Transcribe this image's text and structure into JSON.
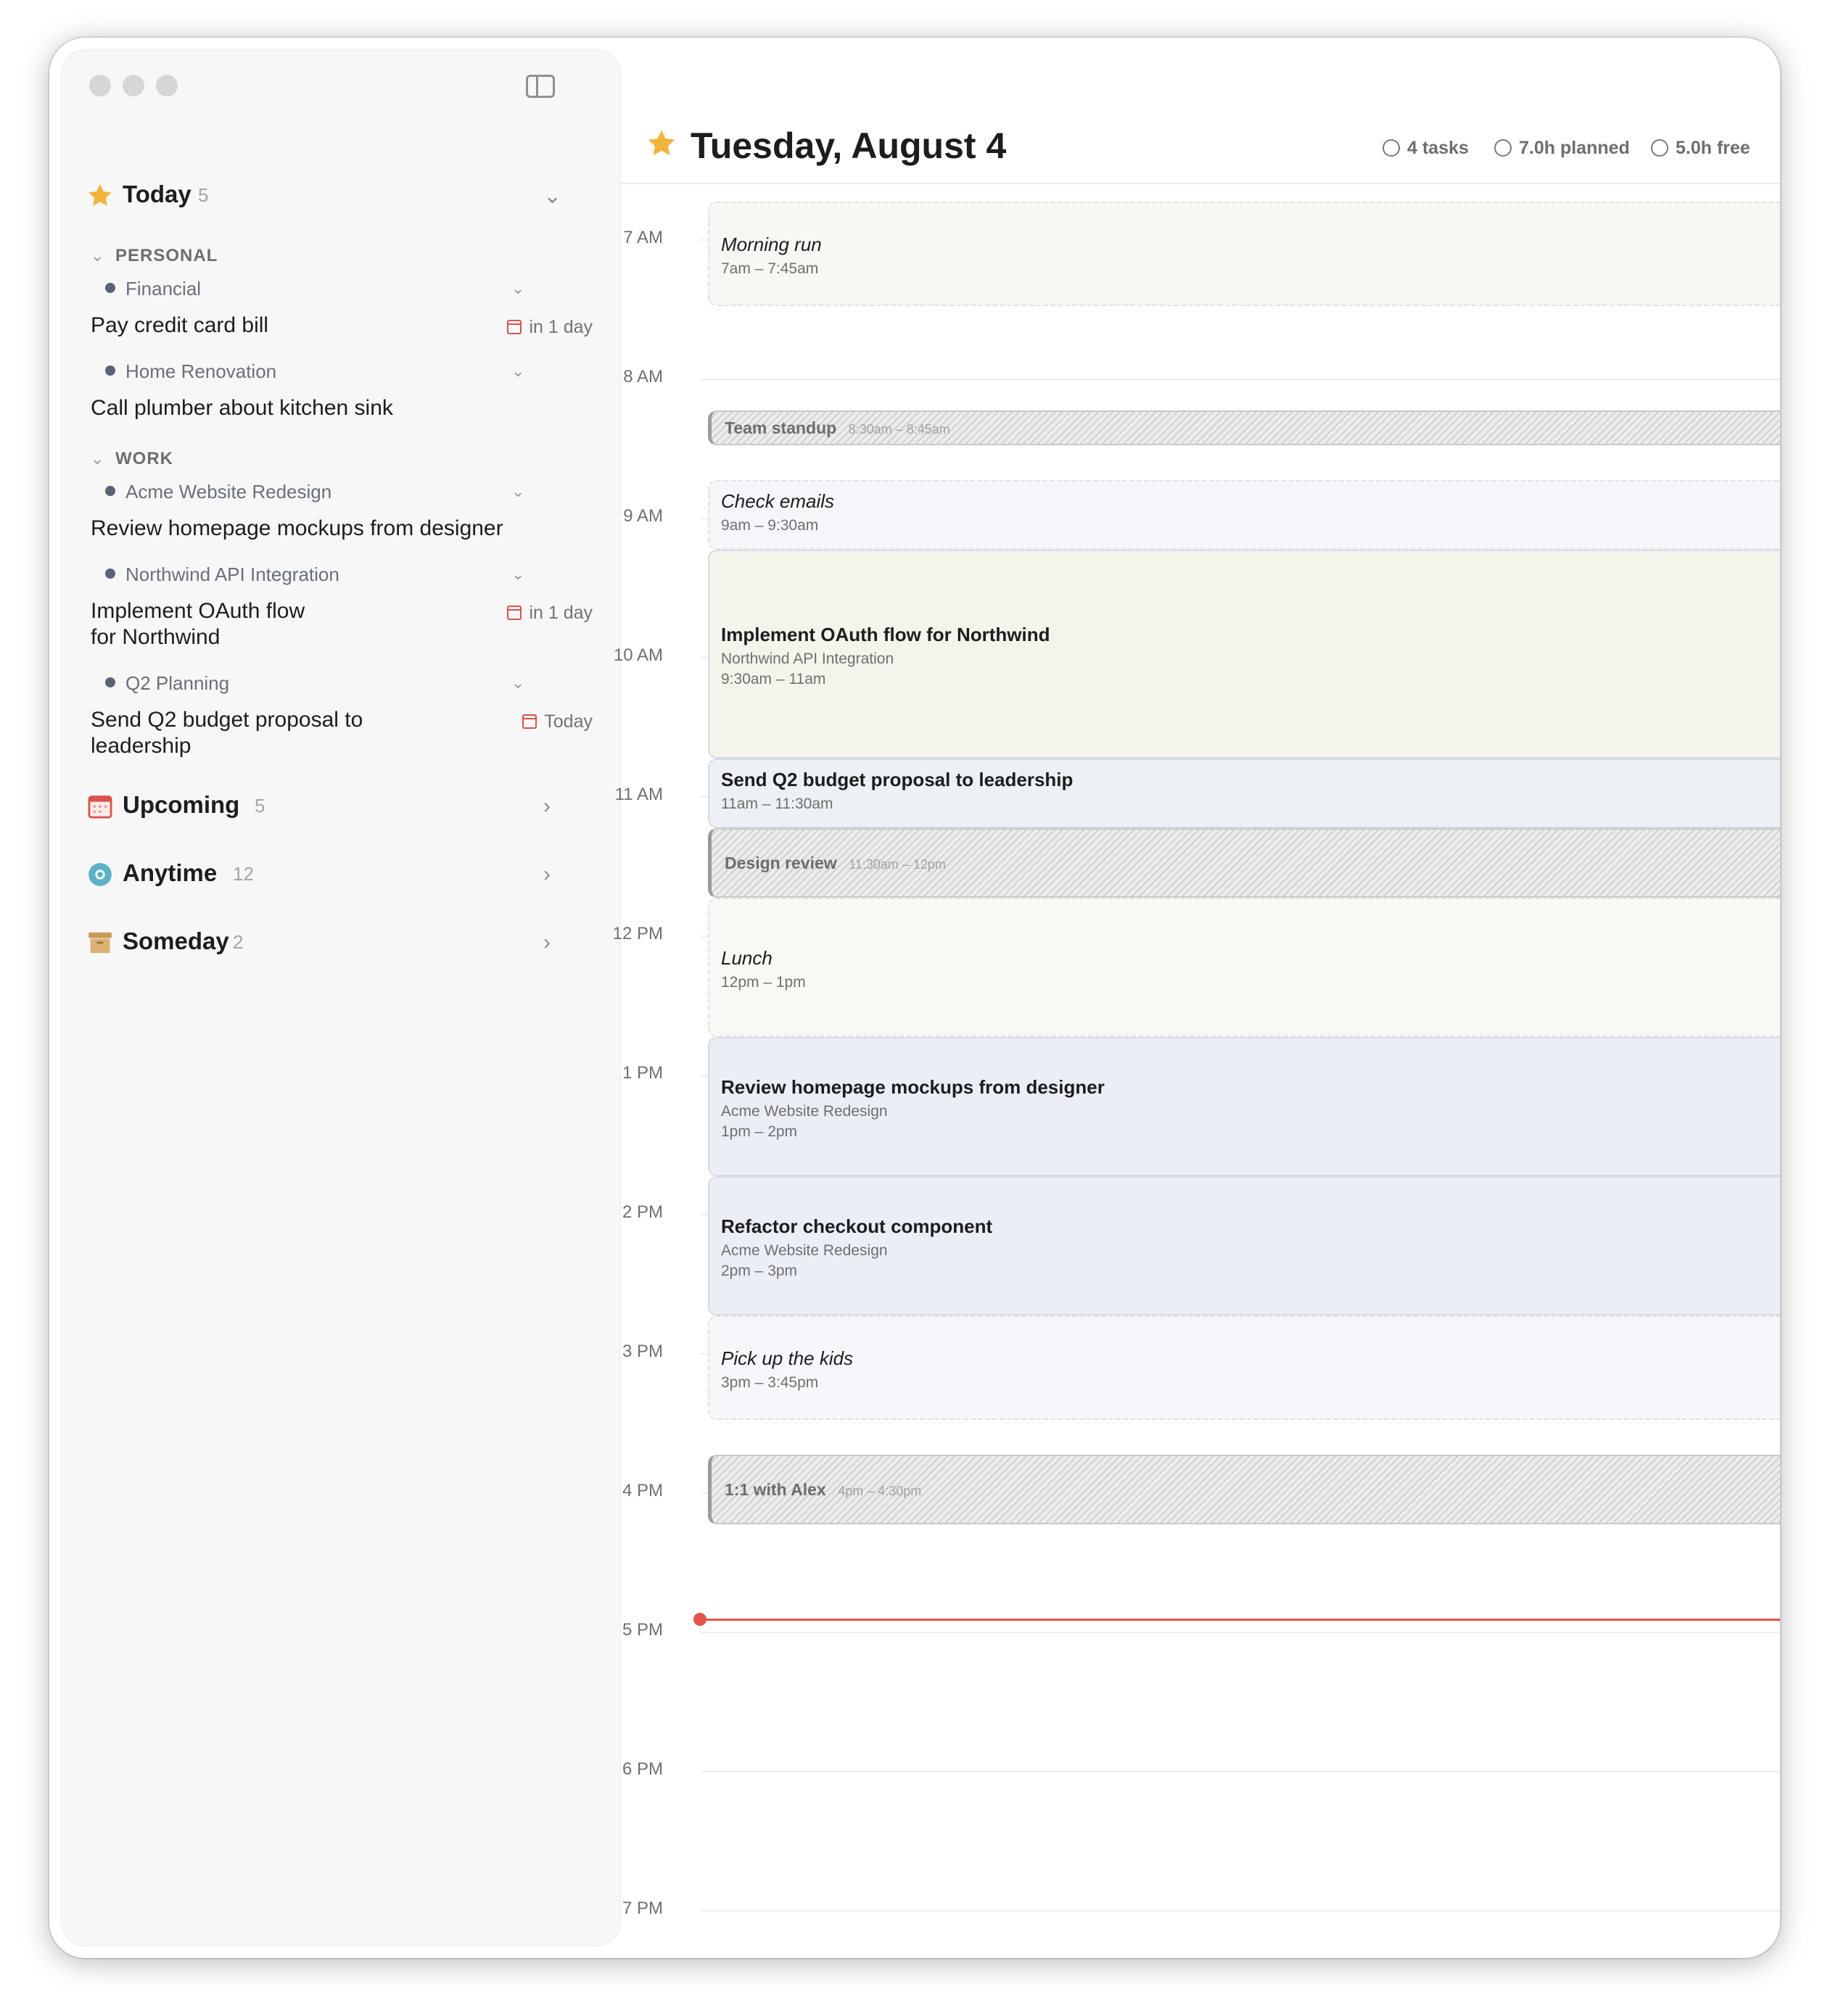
{
  "sidebar": {
    "today": {
      "label": "Today",
      "count": "5"
    },
    "groups": [
      {
        "name": "PERSONAL",
        "projects": [
          {
            "name": "Financial",
            "tasks": [
              {
                "title": "Pay credit card bill",
                "due": "in 1 day"
              }
            ]
          },
          {
            "name": "Home Renovation",
            "tasks": [
              {
                "title": "Call plumber about kitchen sink",
                "due": ""
              }
            ]
          }
        ]
      },
      {
        "name": "WORK",
        "projects": [
          {
            "name": "Acme Website Redesign",
            "tasks": [
              {
                "title": "Review homepage mockups from designer",
                "due": ""
              }
            ]
          },
          {
            "name": "Northwind API Integration",
            "tasks": [
              {
                "title": "Implement OAuth flow for Northwind",
                "due": "in 1 day"
              }
            ]
          },
          {
            "name": "Q2 Planning",
            "tasks": [
              {
                "title": "Send Q2 budget proposal to leadership",
                "due": "Today"
              }
            ]
          }
        ]
      }
    ],
    "sections": [
      {
        "label": "Upcoming",
        "count": "5",
        "icon": "calendar-icon"
      },
      {
        "label": "Anytime",
        "count": "12",
        "icon": "circle-icon"
      },
      {
        "label": "Someday",
        "count": "2",
        "icon": "archive-box-icon"
      }
    ]
  },
  "header": {
    "title": "Tuesday, August 4",
    "tasks": "4 tasks",
    "planned": "7.0h planned",
    "free": "5.0h free"
  },
  "timeline": {
    "hours": [
      "7 AM",
      "8 AM",
      "9 AM",
      "10 AM",
      "11 AM",
      "12 PM",
      "1 PM",
      "2 PM",
      "3 PM",
      "4 PM",
      "5 PM",
      "6 PM",
      "7 PM"
    ],
    "events": [
      {
        "title": "Morning run",
        "time": "7am – 7:45am",
        "kind": "personal",
        "color": "#f6f8f4"
      },
      {
        "title": "Team standup",
        "time": "8:30am – 8:45am",
        "kind": "meeting"
      },
      {
        "title": "Check emails",
        "time": "9am – 9:30am",
        "kind": "personal",
        "color": "#f4f6f9"
      },
      {
        "title": "Implement OAuth flow for Northwind",
        "project": "Northwind API Integration",
        "time": "9:30am – 11am",
        "kind": "work",
        "color": "#f4f4ec"
      },
      {
        "title": "Send Q2 budget proposal to leadership",
        "time": "11am – 11:30am",
        "kind": "work",
        "color": "#edf0f4"
      },
      {
        "title": "Design review",
        "time": "11:30am – 12pm",
        "kind": "meeting"
      },
      {
        "title": "Lunch",
        "time": "12pm – 1pm",
        "kind": "personal",
        "color": "#f9f8f4"
      },
      {
        "title": "Review homepage mockups from designer",
        "project": "Acme Website Redesign",
        "time": "1pm – 2pm",
        "kind": "work",
        "color": "#ebeef5"
      },
      {
        "title": "Refactor checkout component",
        "project": "Acme Website Redesign",
        "time": "2pm – 3pm",
        "kind": "work",
        "color": "#ebeef5"
      },
      {
        "title": "Pick up the kids",
        "time": "3pm – 3:45pm",
        "kind": "personal",
        "color": "#f6f7fa"
      },
      {
        "title": "1:1 with Alex",
        "time": "4pm – 4:30pm",
        "kind": "meeting"
      }
    ]
  },
  "colors": {
    "accent_star": "#f2b53c",
    "now_line": "#e5534b",
    "due_icon": "#d9534f"
  }
}
